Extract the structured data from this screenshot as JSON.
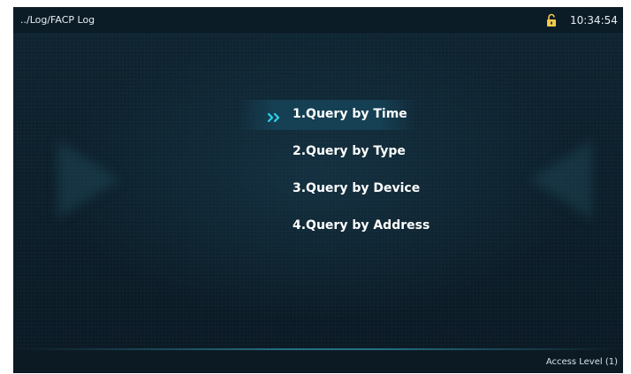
{
  "header": {
    "breadcrumb": "../Log/FACP Log",
    "time": "10:34:54",
    "lock_icon": "unlocked-padlock-icon",
    "accent_color": "#f2c94c"
  },
  "menu": {
    "selected_index": 0,
    "selector_icon": "double-chevron-right-icon",
    "selector_color": "#2fd0e6",
    "items": [
      {
        "label": "1.Query by Time"
      },
      {
        "label": "2.Query by Type"
      },
      {
        "label": "3.Query by Device"
      },
      {
        "label": "4.Query by Address"
      }
    ]
  },
  "footer": {
    "access_level": "Access Level (1)"
  }
}
